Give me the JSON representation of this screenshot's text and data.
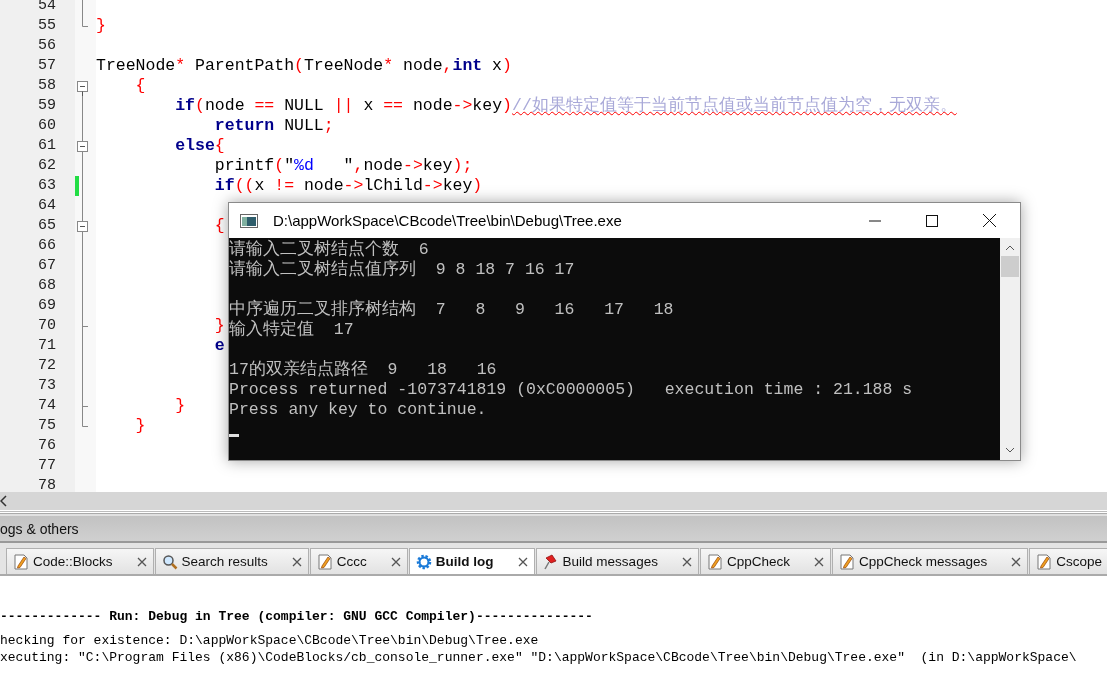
{
  "editor": {
    "lines": [
      {
        "number": "54",
        "kind": "mid",
        "changed": false
      },
      {
        "number": "55",
        "kind": "end",
        "changed": false,
        "tokens": [
          {
            "kind": "op",
            "text": "}"
          }
        ]
      },
      {
        "number": "56",
        "kind": "plain",
        "changed": false
      },
      {
        "number": "57",
        "kind": "plain",
        "changed": false,
        "tokens": [
          {
            "kind": "plain",
            "text": "TreeNode"
          },
          {
            "kind": "op",
            "text": "*"
          },
          {
            "kind": "plain",
            "text": " ParentPath"
          },
          {
            "kind": "op",
            "text": "("
          },
          {
            "kind": "plain",
            "text": "TreeNode"
          },
          {
            "kind": "op",
            "text": "*"
          },
          {
            "kind": "plain",
            "text": " node"
          },
          {
            "kind": "op",
            "text": ","
          },
          {
            "kind": "kw",
            "text": "int"
          },
          {
            "kind": "plain",
            "text": " x"
          },
          {
            "kind": "op",
            "text": ")"
          }
        ]
      },
      {
        "number": "58",
        "kind": "start",
        "changed": false,
        "tokens": [
          {
            "kind": "op",
            "text": "    {"
          }
        ]
      },
      {
        "number": "59",
        "kind": "mid",
        "changed": false,
        "tokens": [
          {
            "kind": "kw",
            "text": "        if"
          },
          {
            "kind": "op",
            "text": "("
          },
          {
            "kind": "plain",
            "text": "node "
          },
          {
            "kind": "op",
            "text": "=="
          },
          {
            "kind": "plain",
            "text": " NULL "
          },
          {
            "kind": "op",
            "text": "||"
          },
          {
            "kind": "plain",
            "text": " x "
          },
          {
            "kind": "op",
            "text": "=="
          },
          {
            "kind": "plain",
            "text": " node"
          },
          {
            "kind": "op",
            "text": "->"
          },
          {
            "kind": "plain",
            "text": "key"
          },
          {
            "kind": "op",
            "text": ")"
          },
          {
            "kind": "comment",
            "text": "//如果特定值等于当前节点值或当前节点值为空，无双亲。"
          }
        ]
      },
      {
        "number": "60",
        "kind": "mid",
        "changed": false,
        "tokens": [
          {
            "kind": "kw",
            "text": "            return"
          },
          {
            "kind": "plain",
            "text": " NULL"
          },
          {
            "kind": "op",
            "text": ";"
          }
        ]
      },
      {
        "number": "61",
        "kind": "inner-start",
        "changed": false,
        "tokens": [
          {
            "kind": "kw",
            "text": "        else"
          },
          {
            "kind": "op",
            "text": "{"
          }
        ]
      },
      {
        "number": "62",
        "kind": "mid",
        "changed": false,
        "tokens": [
          {
            "kind": "plain",
            "text": "            printf"
          },
          {
            "kind": "op",
            "text": "("
          },
          {
            "kind": "plain",
            "text": "\""
          },
          {
            "kind": "str",
            "text": "%d"
          },
          {
            "kind": "plain",
            "text": "   \""
          },
          {
            "kind": "op",
            "text": ","
          },
          {
            "kind": "plain",
            "text": "node"
          },
          {
            "kind": "op",
            "text": "->"
          },
          {
            "kind": "plain",
            "text": "key"
          },
          {
            "kind": "op",
            "text": ");"
          }
        ]
      },
      {
        "number": "63",
        "kind": "mid",
        "changed": true,
        "tokens": [
          {
            "kind": "kw",
            "text": "            if"
          },
          {
            "kind": "op",
            "text": "(("
          },
          {
            "kind": "plain",
            "text": "x "
          },
          {
            "kind": "op",
            "text": "!="
          },
          {
            "kind": "plain",
            "text": " node"
          },
          {
            "kind": "op",
            "text": "->"
          },
          {
            "kind": "plain",
            "text": "lChild"
          },
          {
            "kind": "op",
            "text": "->"
          },
          {
            "kind": "plain",
            "text": "key"
          },
          {
            "kind": "op",
            "text": ")"
          }
        ]
      },
      {
        "number": "64",
        "kind": "mid",
        "changed": false
      },
      {
        "number": "65",
        "kind": "inner-start",
        "changed": false,
        "tokens": [
          {
            "kind": "op",
            "text": "            {"
          }
        ]
      },
      {
        "number": "66",
        "kind": "mid",
        "changed": false
      },
      {
        "number": "67",
        "kind": "mid",
        "changed": false
      },
      {
        "number": "68",
        "kind": "mid",
        "changed": false
      },
      {
        "number": "69",
        "kind": "mid",
        "changed": false
      },
      {
        "number": "70",
        "kind": "inner-end",
        "changed": false,
        "tokens": [
          {
            "kind": "op",
            "text": "            }"
          }
        ]
      },
      {
        "number": "71",
        "kind": "mid",
        "changed": false,
        "tokens": [
          {
            "kind": "kw",
            "text": "            e"
          }
        ]
      },
      {
        "number": "72",
        "kind": "mid",
        "changed": false
      },
      {
        "number": "73",
        "kind": "mid",
        "changed": false
      },
      {
        "number": "74",
        "kind": "inner-end",
        "changed": false,
        "tokens": [
          {
            "kind": "op",
            "text": "        }"
          }
        ]
      },
      {
        "number": "75",
        "kind": "end",
        "changed": false,
        "tokens": [
          {
            "kind": "op",
            "text": "    }"
          }
        ]
      },
      {
        "number": "76",
        "kind": "plain",
        "changed": false
      },
      {
        "number": "77",
        "kind": "plain",
        "changed": false
      },
      {
        "number": "78",
        "kind": "plain",
        "changed": false
      }
    ]
  },
  "console": {
    "title": "D:\\appWorkSpace\\CBcode\\Tree\\bin\\Debug\\Tree.exe",
    "blocks": [
      [
        "请输入二叉树结点个数  6",
        "请输入二叉树结点值序列  9 8 18 7 16 17"
      ],
      [
        "中序遍历二叉排序树结构  7   8   9   16   17   18",
        "输入特定值  17"
      ],
      [
        "17的双亲结点路径  9   18   16",
        "Process returned -1073741819 (0xC0000005)   execution time : 21.188 s",
        "Press any key to continue."
      ]
    ]
  },
  "panel": {
    "title": "ogs & others",
    "tabs": [
      {
        "label": "Code::Blocks",
        "kind": "pencil",
        "selected": false
      },
      {
        "label": "Search results",
        "kind": "search",
        "selected": false
      },
      {
        "label": "Cccc",
        "kind": "pencil",
        "selected": false
      },
      {
        "label": "Build log",
        "kind": "gear",
        "selected": true
      },
      {
        "label": "Build messages",
        "kind": "pin",
        "selected": false
      },
      {
        "label": "CppCheck",
        "kind": "pencil",
        "selected": false
      },
      {
        "label": "CppCheck messages",
        "kind": "pencil",
        "selected": false
      },
      {
        "label": "Cscope",
        "kind": "pencil",
        "selected": false
      }
    ],
    "log": [
      {
        "text": "------------- Run: Debug in Tree (compiler: GNU GCC Compiler)---------------",
        "bold": true
      },
      {
        "text": "hecking for existence: D:\\appWorkSpace\\CBcode\\Tree\\bin\\Debug\\Tree.exe",
        "bold": false
      },
      {
        "text": "xecuting: \"C:\\Program Files (x86)\\CodeBlocks/cb_console_runner.exe\" \"D:\\appWorkSpace\\CBcode\\Tree\\bin\\Debug\\Tree.exe\"  (in D:\\appWorkSpace\\",
        "bold": false
      }
    ]
  }
}
